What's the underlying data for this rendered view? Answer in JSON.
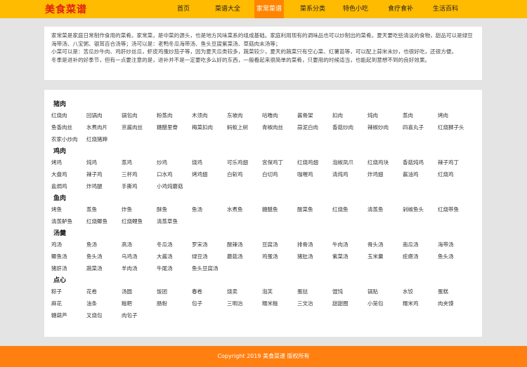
{
  "header": {
    "logo": "美食菜谱",
    "nav": [
      {
        "label": "首页"
      },
      {
        "label": "菜谱大全"
      },
      {
        "label": "家常菜谱",
        "active": true
      },
      {
        "label": "菜系分类"
      },
      {
        "label": "特色小吃"
      },
      {
        "label": "食疗食补"
      },
      {
        "label": "生活百科"
      }
    ]
  },
  "intro": {
    "paragraphs": [
      "家常菜是家庭日常制作食用的菜肴。家常菜，是中菜的源头，也是地方风味菜系的组成基础。家庭利用现有的调味品也可以炒制出的菜肴。夏天要吃些清淡的食物，甜品可以是绿豆海带汤、八宝粥、银耳百合汤等；汤可以是：老鸭冬瓜海带汤、鱼头豆腐紫菜汤、草菇肉末汤等；",
      "小菜可以是：苦瓜炒牛肉、鸡肝炒丝瓜，虾皮鸡蛋炒茄子等，因为夏天瓜类较多，蔬菜较少，夏天的蔬菜只有空心菜、红薯苗等，可以配上蒜米末炒，也很好吃，还很方便。",
      "冬季是进补的好季节，但有一点要注意的是，进补并不是一定要吃多么好的东西，一般看起来很简单的菜肴，只要用的时候适当，也能起到意想不到的良好效果。"
    ]
  },
  "categories": [
    {
      "title": "猪肉",
      "items": [
        "红烧肉",
        "回锅肉",
        "锅包肉",
        "粉蒸肉",
        "木须肉",
        "东坡肉",
        "咕噜肉",
        "酱骨架",
        "扣肉",
        "炖肉",
        "蒸肉",
        "烤肉",
        "鱼香肉丝",
        "水煮肉片",
        "京酱肉丝",
        "糖醋里脊",
        "梅菜扣肉",
        "蚂蚁上树",
        "青椒肉丝",
        "蒜泥白肉",
        "香菇炒肉",
        "辣椒炒肉",
        "四喜丸子",
        "红烧狮子头",
        "农家小炒肉",
        "红烧猪蹄"
      ]
    },
    {
      "title": "鸡肉",
      "items": [
        "烤鸡",
        "炖鸡",
        "蒸鸡",
        "炒鸡",
        "烧鸡",
        "可乐鸡翅",
        "宫保鸡丁",
        "红烧鸡翅",
        "泡椒凤爪",
        "红烧鸡块",
        "香菇炖鸡",
        "辣子鸡丁",
        "大盘鸡",
        "辣子鸡",
        "三杯鸡",
        "口水鸡",
        "烤鸡翅",
        "白斩鸡",
        "白切鸡",
        "咖喱鸡",
        "清炖鸡",
        "炸鸡翅",
        "酱油鸡",
        "红烧鸡",
        "盐焗鸡",
        "炸鸡腿",
        "手撕鸡",
        "小鸡炖蘑菇"
      ]
    },
    {
      "title": "鱼肉",
      "items": [
        "烤鱼",
        "蒸鱼",
        "炸鱼",
        "酥鱼",
        "鱼汤",
        "水煮鱼",
        "糖醋鱼",
        "酸菜鱼",
        "红烧鱼",
        "清蒸鱼",
        "剁椒鱼头",
        "红烧带鱼",
        "清蒸鲈鱼",
        "红烧鲫鱼",
        "红烧鲤鱼",
        "清蒸草鱼"
      ]
    },
    {
      "title": "汤羹",
      "items": [
        "鸡汤",
        "鱼汤",
        "高汤",
        "冬瓜汤",
        "罗宋汤",
        "酸辣汤",
        "豆腐汤",
        "排骨汤",
        "牛肉汤",
        "骨头汤",
        "南瓜汤",
        "海带汤",
        "鲫鱼汤",
        "鱼头汤",
        "乌鸡汤",
        "大酱汤",
        "绿豆汤",
        "蘑菇汤",
        "鸡蛋汤",
        "猪肚汤",
        "紫菜汤",
        "玉米羹",
        "疙瘩汤",
        "鱼头汤",
        "猪肝汤",
        "蔬菜汤",
        "羊肉汤",
        "牛尾汤",
        "鱼头豆腐汤"
      ]
    },
    {
      "title": "点心",
      "items": [
        "粽子",
        "花卷",
        "汤圆",
        "饭团",
        "春卷",
        "烧卖",
        "泡芙",
        "蛋挞",
        "馄饨",
        "锅贴",
        "水饺",
        "蛋糕",
        "麻花",
        "油条",
        "糍粑",
        "肠粉",
        "包子",
        "三明治",
        "糯米糍",
        "三文治",
        "甜甜圈",
        "小笼包",
        "糯米鸡",
        "肉夹馍",
        "糖葫芦",
        "叉烧包",
        "肉包子"
      ]
    }
  ],
  "footer": {
    "copyright": "Copyright 2019 美食菜谱 版权所有"
  }
}
